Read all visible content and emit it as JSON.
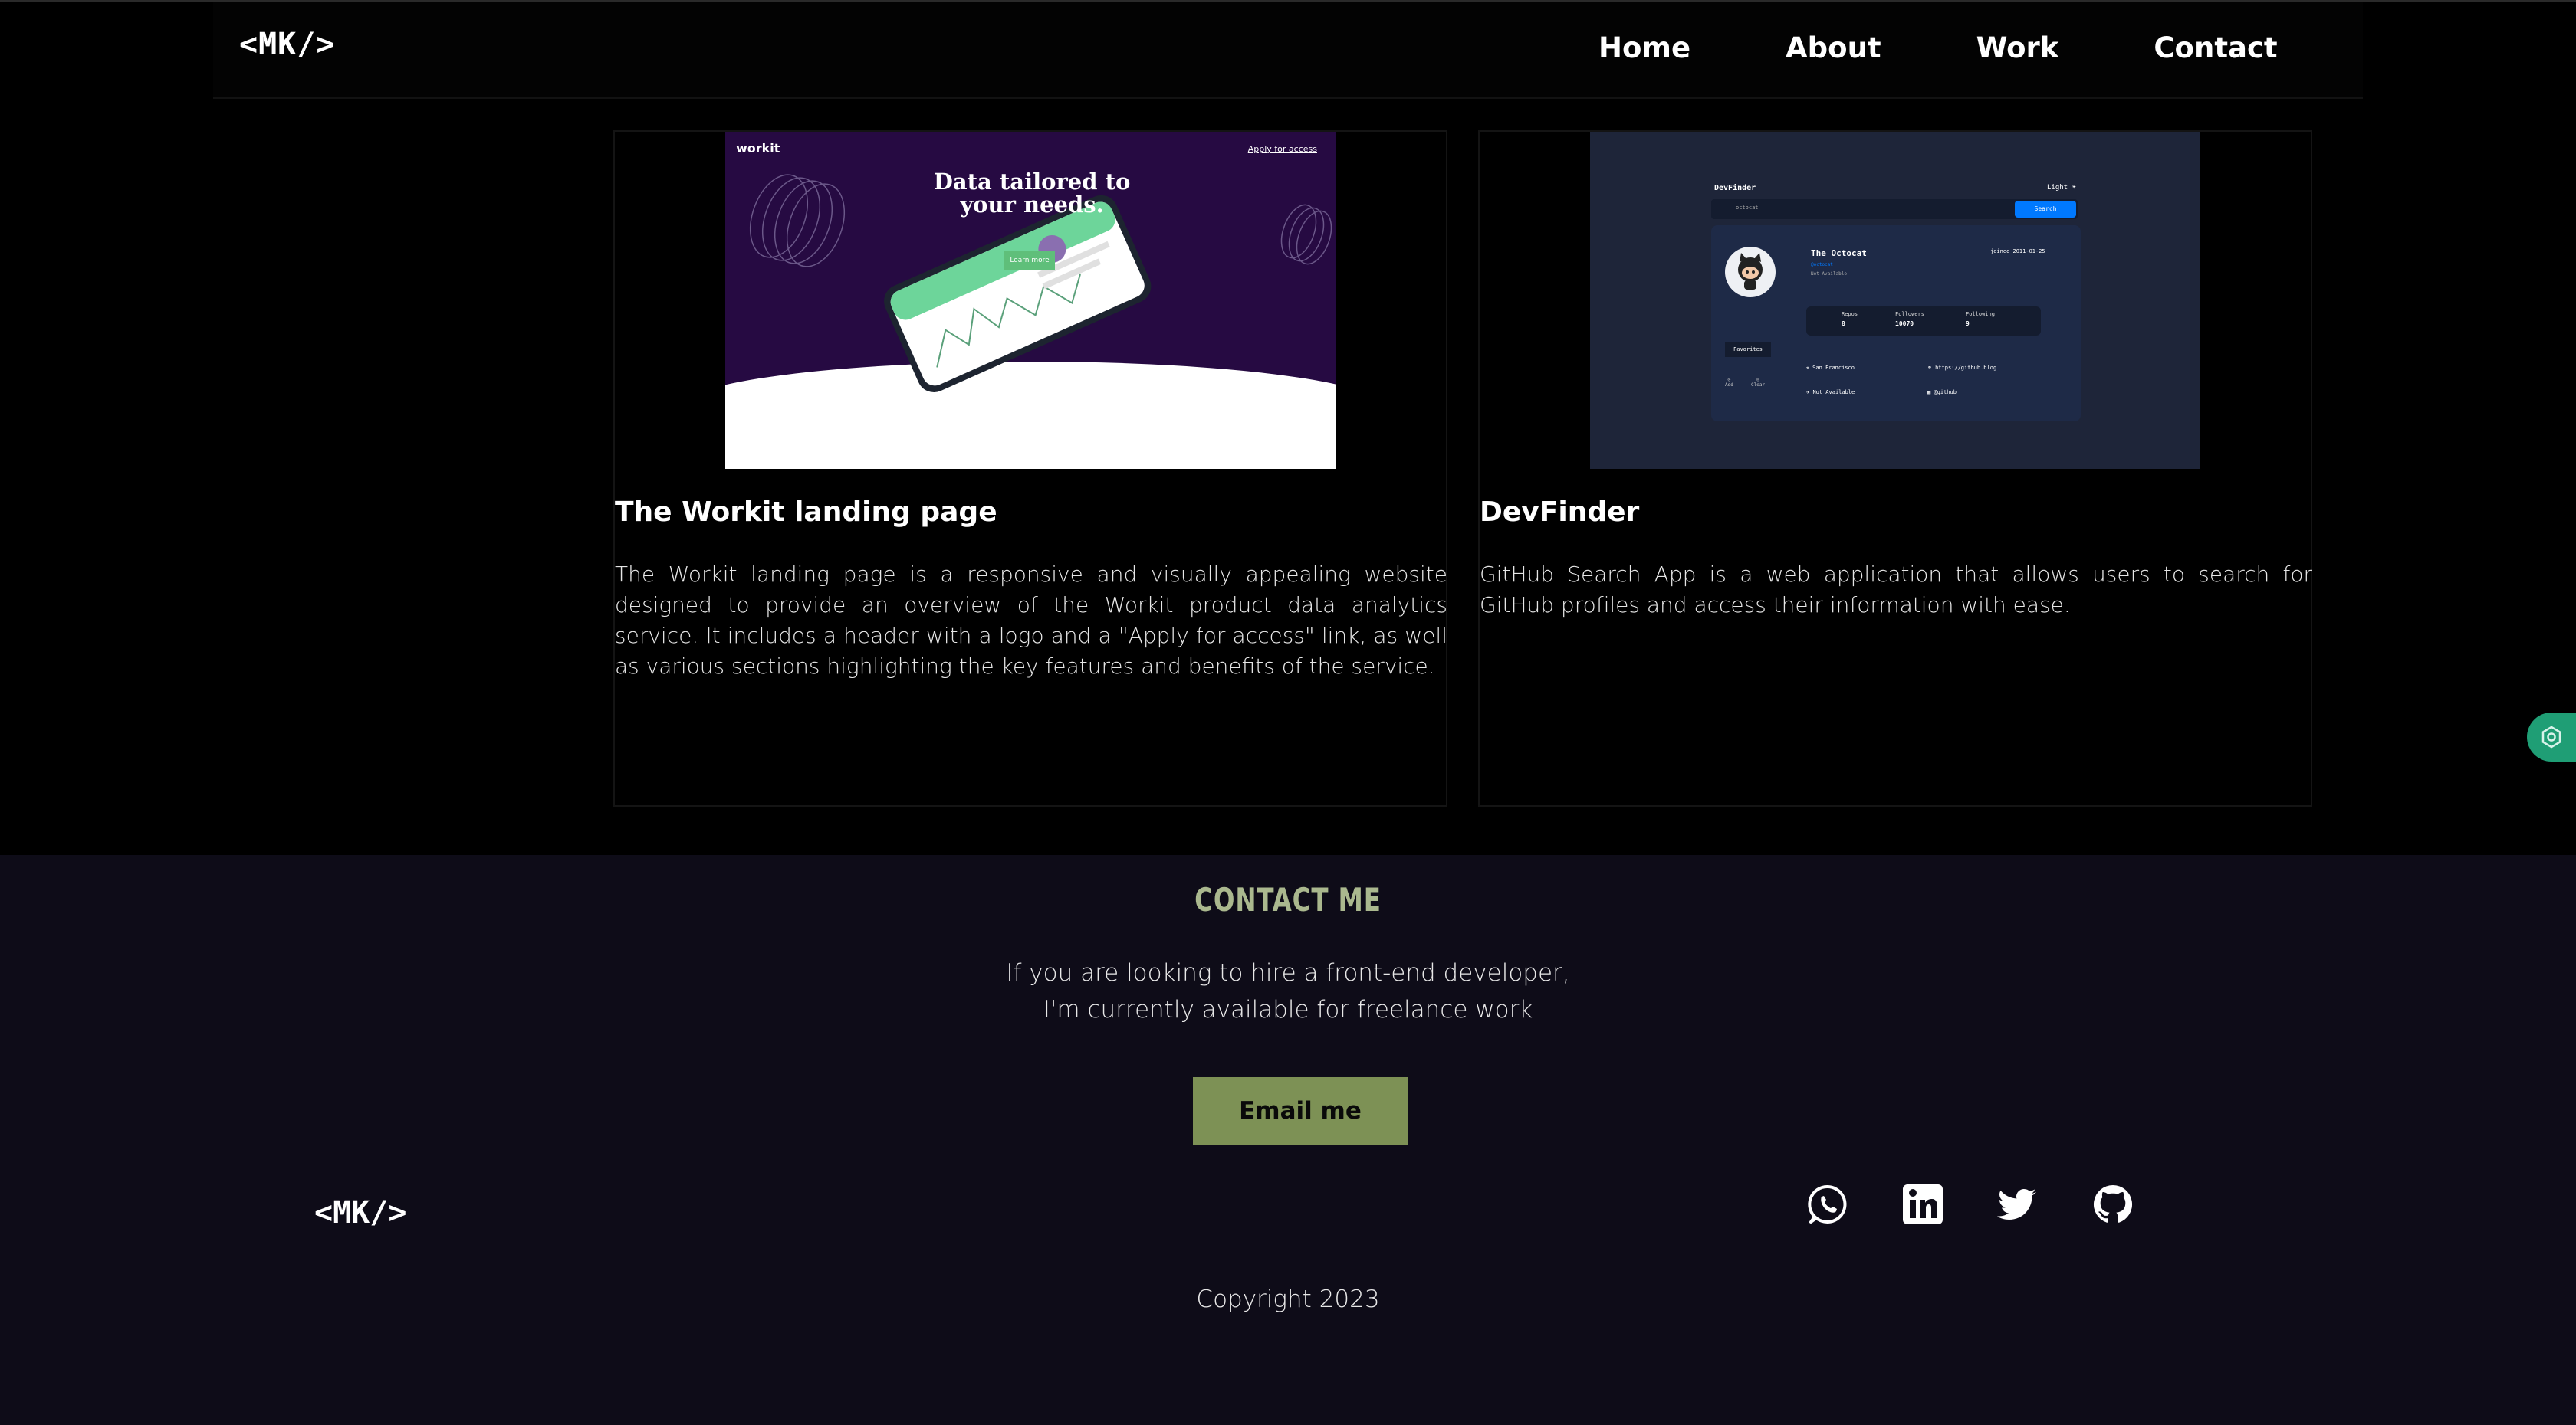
{
  "header": {
    "logo": "<MK/>",
    "nav": [
      {
        "label": "Home"
      },
      {
        "label": "About"
      },
      {
        "label": "Work"
      },
      {
        "label": "Contact"
      }
    ]
  },
  "projects": [
    {
      "title": "The Workit landing page",
      "description": "The Workit landing page is a responsive and visually appealing website designed to provide an overview of the Workit product data analytics service. It includes a header with a logo and a \"Apply for access\" link, as well as various sections highlighting the key features and benefits of the service.",
      "thumb": {
        "logo": "workit",
        "apply": "Apply for access",
        "headline": "Data tailored to your needs.",
        "button": "Learn more"
      }
    },
    {
      "title": "DevFinder",
      "description": "GitHub Search App is a web application that allows users to search for GitHub profiles and access their information with ease.",
      "thumb": {
        "app_title": "DevFinder",
        "theme": "Light",
        "search_value": "octocat",
        "search_button": "Search",
        "name": "The Octocat",
        "joined": "joined 2011-01-25",
        "handle": "@octocat",
        "bio": "Not Available",
        "stats": [
          {
            "label": "Repos",
            "value": "8"
          },
          {
            "label": "Followers",
            "value": "10070"
          },
          {
            "label": "Following",
            "value": "9"
          }
        ],
        "favorites": "Favorites",
        "location": "San Francisco",
        "blog": "https://github.blog",
        "twitter": "Not Available",
        "company": "@github",
        "mini": [
          "Add",
          "Clear"
        ]
      }
    }
  ],
  "contact": {
    "title": "CONTACT ME",
    "line1": "If you are looking to hire a front-end developer,",
    "line2": "I'm currently available for freelance work",
    "button": "Email me"
  },
  "footer": {
    "logo": "<MK/>",
    "socials": [
      "whatsapp-icon",
      "linkedin-icon",
      "twitter-icon",
      "github-icon"
    ],
    "copyright": "Copyright 2023"
  },
  "colors": {
    "accent": "#aab88e",
    "button": "#7d9155",
    "footer_bg": "#0e0c18",
    "widget": "#1f9e75"
  }
}
